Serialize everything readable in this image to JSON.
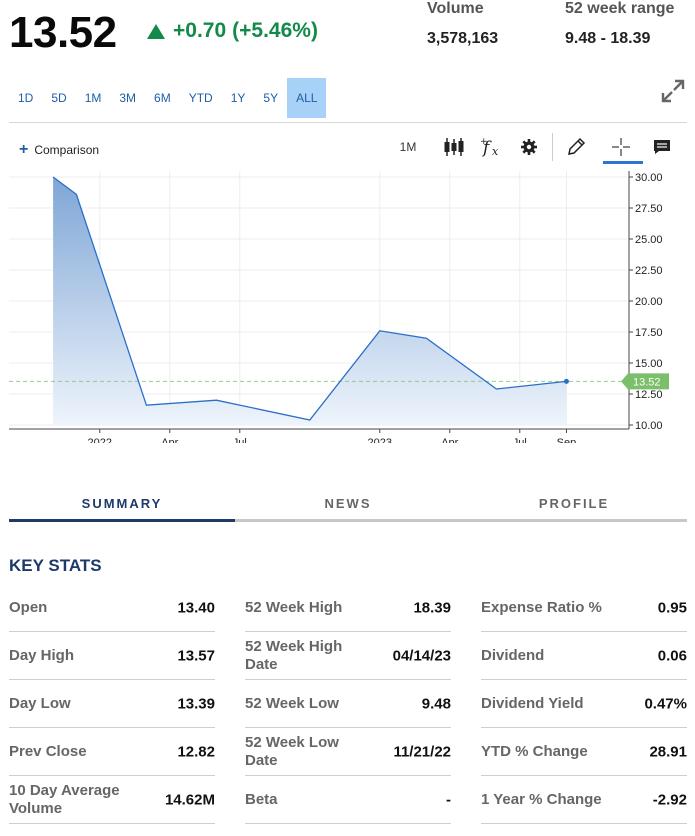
{
  "quote": {
    "price": "13.52",
    "change": "+0.70",
    "change_pct": "(+5.46%)",
    "volume_label": "Volume",
    "volume": "3,578,163",
    "range_label": "52 week range",
    "range": "9.48 - 18.39"
  },
  "ranges": [
    "1D",
    "5D",
    "1M",
    "3M",
    "6M",
    "YTD",
    "1Y",
    "5Y",
    "ALL"
  ],
  "active_range": "ALL",
  "toolbar": {
    "comparison_label": "Comparison",
    "interval": "1M"
  },
  "colors": {
    "line": "#2a6fc9",
    "area_top": "#7fa6d6",
    "area_bottom": "#eef4fb",
    "price_tag": "#7bbf6a",
    "positive": "#138a4a",
    "accent": "#1d3a6b"
  },
  "chart_data": {
    "type": "area",
    "x_ticks": [
      "2022",
      "Apr",
      "Jul",
      "2023",
      "Apr",
      "Jul",
      "Sep"
    ],
    "y_ticks": [
      "30.00",
      "27.50",
      "25.00",
      "22.50",
      "20.00",
      "17.50",
      "15.00",
      "12.50",
      "10.00"
    ],
    "ylim": [
      10,
      30
    ],
    "series": [
      {
        "x": [
          "2021-11",
          "2021-12",
          "2022-03",
          "2022-06",
          "2022-10",
          "2023-01",
          "2023-03",
          "2023-06",
          "2023-08-31"
        ],
        "values": [
          30.0,
          28.6,
          11.6,
          12.0,
          10.4,
          17.6,
          17.0,
          12.9,
          13.52
        ]
      }
    ],
    "last_price_tag": "13.52",
    "grid": true
  },
  "tabs": [
    "SUMMARY",
    "NEWS",
    "PROFILE"
  ],
  "active_tab": "SUMMARY",
  "key_stats_title": "KEY STATS",
  "stats": {
    "col1": [
      {
        "label": "Open",
        "value": "13.40"
      },
      {
        "label": "Day High",
        "value": "13.57"
      },
      {
        "label": "Day Low",
        "value": "13.39"
      },
      {
        "label": "Prev Close",
        "value": "12.82"
      },
      {
        "label": "10 Day Average Volume",
        "value": "14.62M"
      }
    ],
    "col2": [
      {
        "label": "52 Week High",
        "value": "18.39"
      },
      {
        "label": "52 Week High Date",
        "value": "04/14/23"
      },
      {
        "label": "52 Week Low",
        "value": "9.48"
      },
      {
        "label": "52 Week Low Date",
        "value": "11/21/22"
      },
      {
        "label": "Beta",
        "value": "-"
      }
    ],
    "col3": [
      {
        "label": "Expense Ratio %",
        "value": "0.95"
      },
      {
        "label": "Dividend",
        "value": "0.06"
      },
      {
        "label": "Dividend Yield",
        "value": "0.47%"
      },
      {
        "label": "YTD % Change",
        "value": "28.91"
      },
      {
        "label": "1 Year % Change",
        "value": "-2.92"
      }
    ]
  }
}
